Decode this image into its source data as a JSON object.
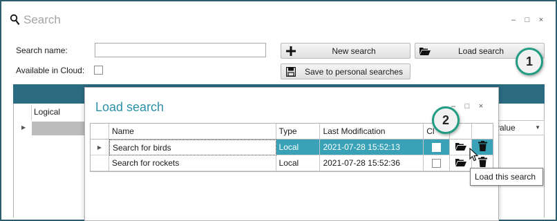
{
  "window": {
    "title": "Search",
    "search_icon": "magnifier-icon",
    "controls": {
      "minimize": "–",
      "maximize": "□",
      "close": "×"
    }
  },
  "form": {
    "search_name_label": "Search name:",
    "search_name_value": "",
    "available_in_cloud_label": "Available in Cloud:",
    "available_in_cloud_checked": false
  },
  "buttons": {
    "new_search": "New search",
    "new_search_icon": "plus-icon",
    "load_search": "Load search",
    "load_search_icon": "folder-open-icon",
    "save_personal": "Save to personal searches",
    "save_personal_icon": "floppy-disk-icon"
  },
  "callouts": {
    "one": "1",
    "two": "2"
  },
  "background_grid": {
    "header_logical": "Logical",
    "header_value": "value",
    "header_color": "#2b6b80"
  },
  "dialog": {
    "title": "Load search",
    "controls": {
      "minimize": "–",
      "maximize": "□",
      "close": "×"
    },
    "columns": {
      "name": "Name",
      "type": "Type",
      "last_modification": "Last Modification",
      "cloud": "Cl"
    },
    "rows": [
      {
        "name": "Search for birds",
        "type": "Local",
        "last_modification": "2021-07-28 15:52:13",
        "cloud": false,
        "selected": true
      },
      {
        "name": "Search for rockets",
        "type": "Local",
        "last_modification": "2021-07-28 15:52:36",
        "cloud": false,
        "selected": false
      }
    ],
    "selection_color": "#3aa2b7"
  },
  "tooltip": {
    "text": "Load this search"
  },
  "colors": {
    "frame": "#2b5d6e",
    "accent": "#2b8fa8",
    "callout_ring": "#1f9c82"
  }
}
